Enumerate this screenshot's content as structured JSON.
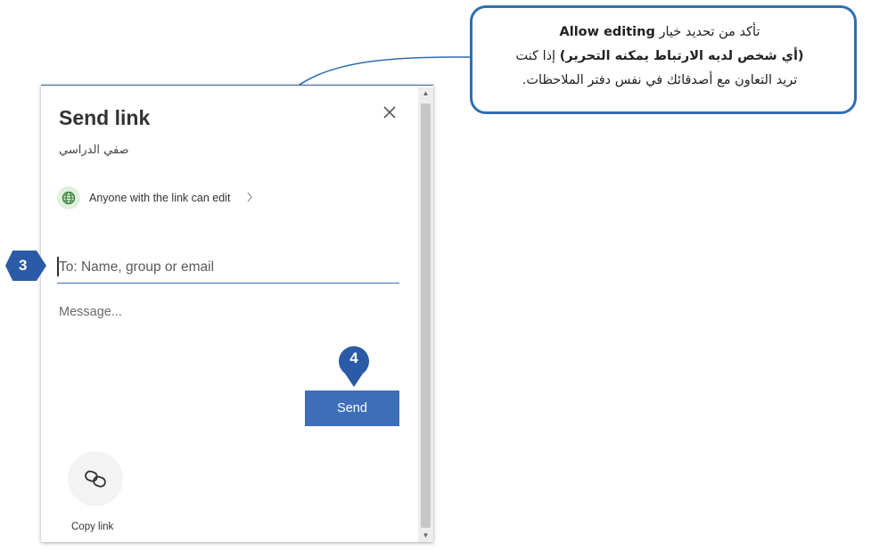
{
  "dialog": {
    "title": "Send link",
    "subtitle": "صفي الدراسي",
    "permission_text": "Anyone with the link can edit",
    "to_placeholder": "To: Name, group or email",
    "message_placeholder": "Message...",
    "send_label": "Send",
    "copy_link_label": "Copy link"
  },
  "steps": {
    "step3": "3",
    "step4": "4"
  },
  "callout": {
    "line1_prefix": "تأكد من تحديد خيار",
    "line1_option": "Allow editing",
    "line2_bold": "(أي شخص لديه الارتباط يمكنه التحرير)",
    "line2_rest": "إذا كنت",
    "line3": "تريد التعاون مع أصدقائك في نفس دفتر الملاحظات."
  },
  "colors": {
    "accent": "#3f6eb8",
    "step_marker": "#2b5aa6",
    "callout_border": "#2f6eb5"
  },
  "icons": {
    "close": "close-icon",
    "globe": "globe-icon",
    "chevron": "chevron-right-icon",
    "copy_link": "link-icon"
  }
}
